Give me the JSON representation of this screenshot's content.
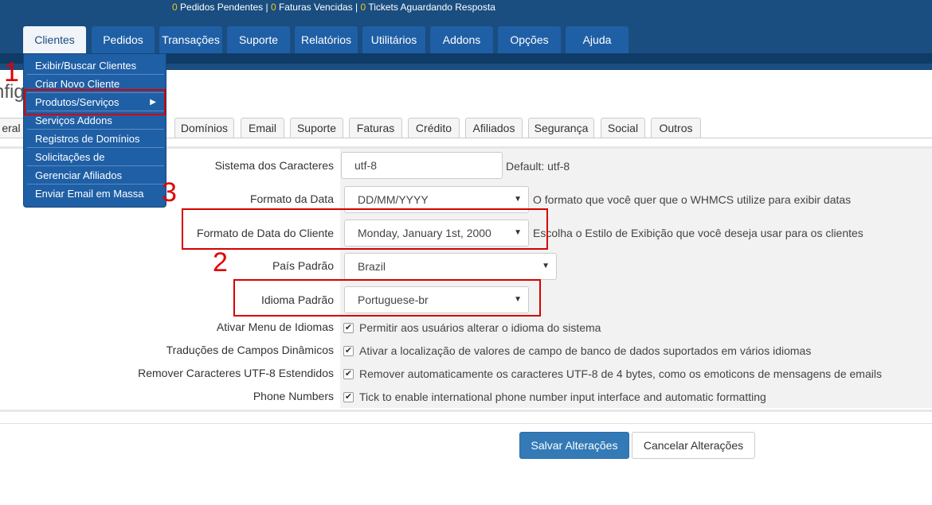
{
  "header": {
    "stats": [
      {
        "count": "0",
        "label": "Pedidos Pendentes"
      },
      {
        "count": "0",
        "label": "Faturas Vencidas"
      },
      {
        "count": "0",
        "label": "Tickets Aguardando Resposta"
      }
    ],
    "separator": "|",
    "nav": [
      "Clientes",
      "Pedidos",
      "Transações",
      "Suporte",
      "Relatórios",
      "Utilitários",
      "Addons",
      "Opções",
      "Ajuda"
    ]
  },
  "dropdown": {
    "items": [
      "Exibir/Buscar Clientes",
      "Criar Novo Cliente",
      "Produtos/Serviços",
      "Serviços Addons",
      "Registros de Domínios",
      "Solicitações de",
      "Gerenciar Afiliados",
      "Enviar Email em Massa"
    ],
    "submenu_arrow": "▶"
  },
  "page": {
    "title_fragment": "nfig"
  },
  "settings_tabs": [
    "eral",
    "Domínios",
    "Email",
    "Suporte",
    "Faturas",
    "Crédito",
    "Afiliados",
    "Segurança",
    "Social",
    "Outros"
  ],
  "form": {
    "charset": {
      "label": "Sistema dos Caracteres",
      "value": "utf-8",
      "help": "Default: utf-8"
    },
    "date_format": {
      "label": "Formato da Data",
      "value": "DD/MM/YYYY",
      "help": "O formato que você quer que o WHMCS utilize para exibir datas"
    },
    "client_date_format": {
      "label": "Formato de Data do Cliente",
      "value": "Monday, January 1st, 2000",
      "help": "Escolha o Estilo de Exibição que você deseja usar para os clientes"
    },
    "default_country": {
      "label": "País Padrão",
      "value": "Brazil"
    },
    "default_language": {
      "label": "Idioma Padrão",
      "value": "Portuguese-br"
    },
    "language_menu": {
      "label": "Ativar Menu de Idiomas",
      "text": "Permitir aos usuários alterar o idioma do sistema",
      "checked": true
    },
    "dynamic_translations": {
      "label": "Traduções de Campos Dinâmicos",
      "text": "Ativar a localização de valores de campo de banco de dados suportados em vários idiomas",
      "checked": true
    },
    "remove_utf8": {
      "label": "Remover Caracteres UTF-8 Estendidos",
      "text": "Remover automaticamente os caracteres UTF-8 de 4 bytes, como os emoticons de mensagens de emails",
      "checked": true
    },
    "phone_numbers": {
      "label": "Phone Numbers",
      "text": "Tick to enable international phone number input interface and automatic formatting",
      "checked": true
    },
    "caret": "▼",
    "check": "✔"
  },
  "buttons": {
    "save": "Salvar Alterações",
    "cancel": "Cancelar Alterações"
  },
  "annotations": [
    "1",
    "2",
    "3"
  ],
  "colors": {
    "header": "#1a4d80",
    "nav_tab": "#1f5fa6",
    "annotation": "#d60000",
    "primary_button": "#337ab7"
  }
}
